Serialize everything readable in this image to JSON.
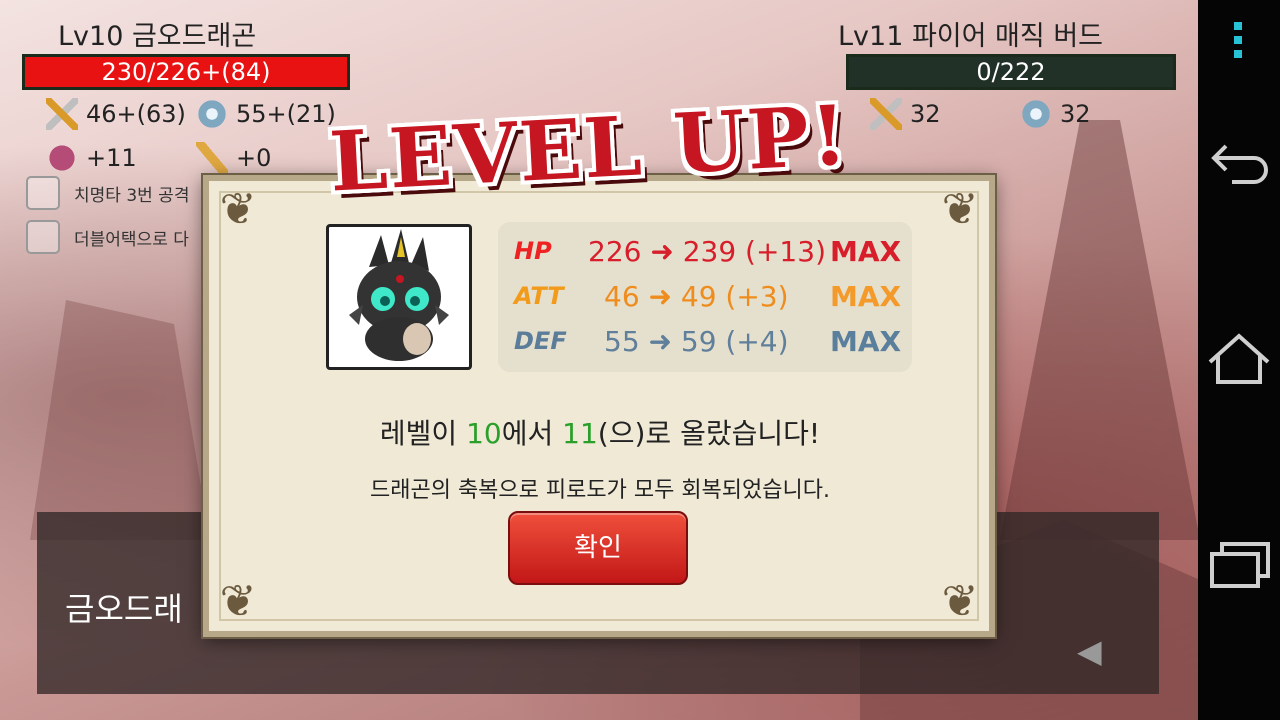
{
  "player": {
    "name": "Lv10 금오드래곤",
    "hp": "230/226+(84)",
    "att": "46+(63)",
    "def": "55+(21)",
    "crit": "+11",
    "speed": "+0"
  },
  "enemy": {
    "name": "Lv11 파이어 매직 버드",
    "hp": "0/222",
    "att": "32",
    "def": "32"
  },
  "options": [
    {
      "label": "치명타 3번 공격"
    },
    {
      "label": "더블어택으로 다"
    }
  ],
  "message_panel": {
    "text": "금오드래",
    "next_arrow": "◀"
  },
  "level_up": {
    "title": "LEVEL UP!",
    "stats": [
      {
        "label": "HP",
        "value": "226 ➜ 239 (+13)",
        "max": "MAX"
      },
      {
        "label": "ATT",
        "value": "46 ➜ 49 (+3)",
        "max": "MAX"
      },
      {
        "label": "DEF",
        "value": "55 ➜ 59 (+4)",
        "max": "MAX"
      }
    ],
    "line1_prefix": "레벨이 ",
    "line1_from": "10",
    "line1_mid": "에서 ",
    "line1_to": "11",
    "line1_suffix": "(으)로 올랐습니다!",
    "line2": "드래곤의 축복으로 피로도가 모두 회복되었습니다.",
    "confirm_label": "확인"
  },
  "colors": {
    "hp_bar_player": "#e81212",
    "hp_bar_enemy": "#223127",
    "title_red": "#c51622",
    "confirm_button": "#d82a22",
    "highlight_green": "#2aa02a"
  },
  "icons": {
    "attack": "crossed-swords-icon",
    "defense": "shield-icon",
    "crit": "heart-icon",
    "speed": "feather-icon",
    "nav": [
      "menu-icon",
      "back-icon",
      "home-icon",
      "recent-apps-icon"
    ]
  }
}
